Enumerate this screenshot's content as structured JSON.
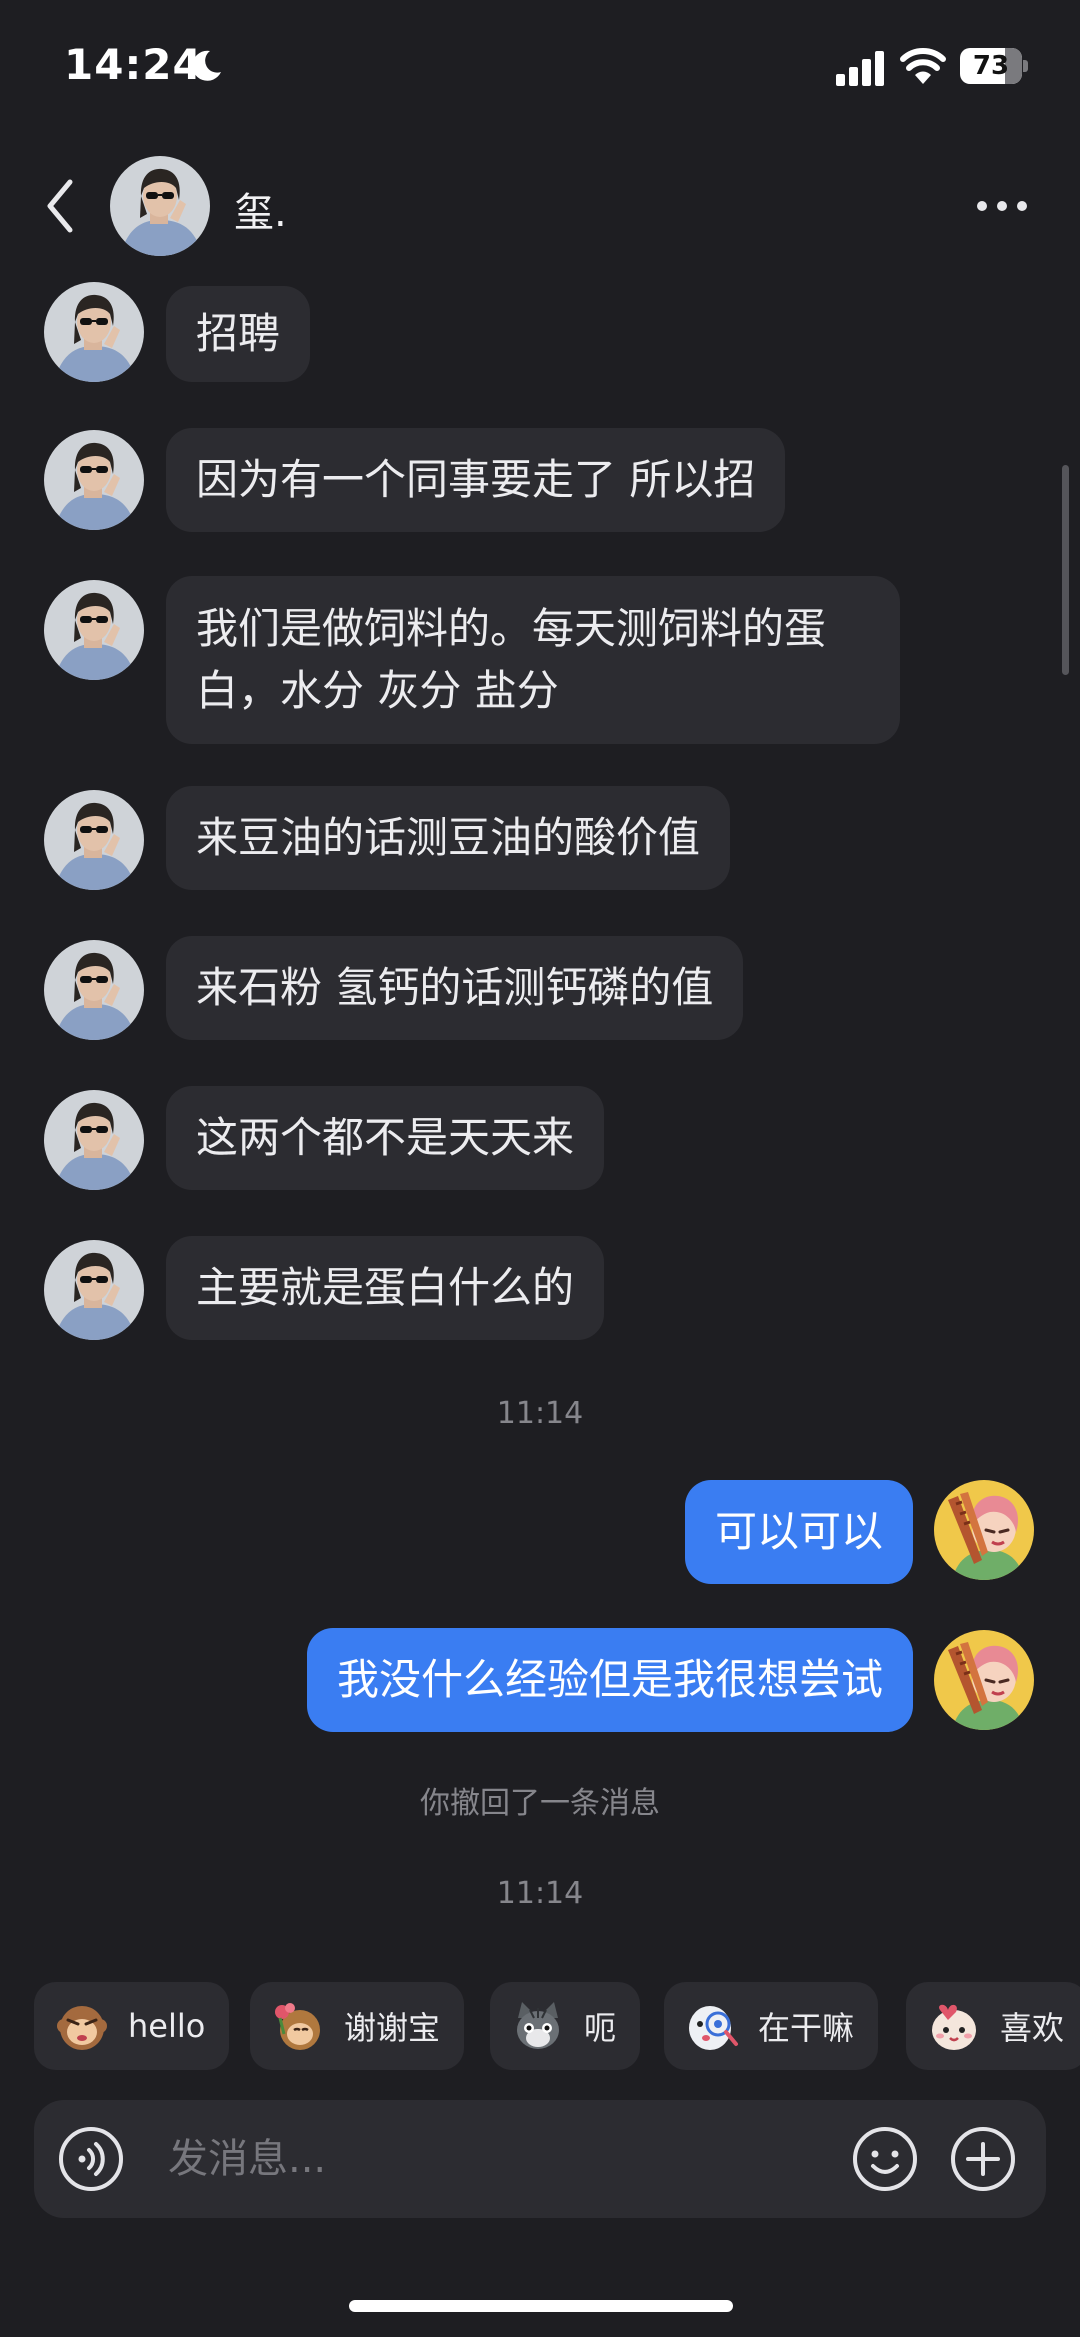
{
  "status_bar": {
    "time": "14:24",
    "battery": "73",
    "battery_level": 0.73
  },
  "header": {
    "contact_name": "玺."
  },
  "messages": [
    {
      "side": "in",
      "text": "招聘"
    },
    {
      "side": "in",
      "text": "因为有一个同事要走了 所以招"
    },
    {
      "side": "in",
      "text": "我们是做饲料的。每天测饲料的蛋白，水分 灰分 盐分"
    },
    {
      "side": "in",
      "text": "来豆油的话测豆油的酸价值"
    },
    {
      "side": "in",
      "text": "来石粉 氢钙的话测钙磷的值"
    },
    {
      "side": "in",
      "text": "这两个都不是天天来"
    },
    {
      "side": "in",
      "text": "主要就是蛋白什么的"
    },
    {
      "type": "timestamp",
      "text": "11:14"
    },
    {
      "side": "out",
      "text": "可以可以"
    },
    {
      "side": "out",
      "text": "我没什么经验但是我很想尝试"
    },
    {
      "type": "system",
      "text": "你撤回了一条消息"
    },
    {
      "type": "timestamp",
      "text": "11:14"
    }
  ],
  "quick_replies": [
    {
      "label": "hello",
      "icon": "monkey-emoji-icon"
    },
    {
      "label": "谢谢宝",
      "icon": "thanks-emoji-icon"
    },
    {
      "label": "呃",
      "icon": "cat-emoji-icon"
    },
    {
      "label": "在干嘛",
      "icon": "peek-emoji-icon"
    },
    {
      "label": "喜欢",
      "icon": "love-emoji-icon"
    }
  ],
  "input": {
    "placeholder": "发消息..."
  },
  "colors": {
    "background": "#1e1e22",
    "incoming_bubble": "#2c2c31",
    "outgoing_bubble": "#3a7df2"
  }
}
